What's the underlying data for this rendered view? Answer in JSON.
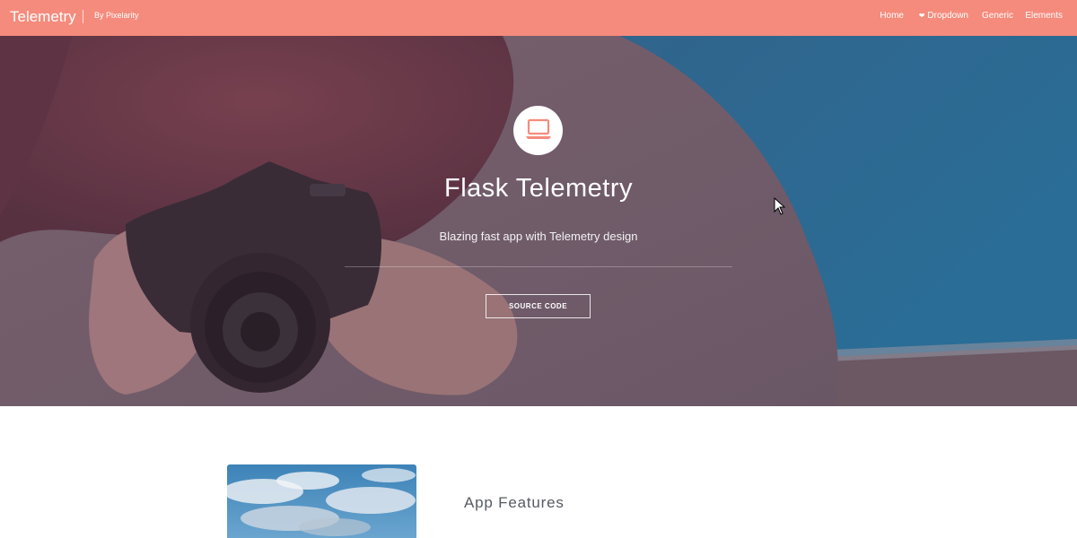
{
  "header": {
    "brand": "Telemetry",
    "by_line": "By Pixelarity",
    "nav": [
      {
        "label": "Home"
      },
      {
        "label": "Dropdown",
        "icon": "heart-icon"
      },
      {
        "label": "Generic"
      },
      {
        "label": "Elements"
      }
    ]
  },
  "hero": {
    "icon": "laptop-icon",
    "title": "Flask Telemetry",
    "subtitle": "Blazing fast app with Telemetry design",
    "button_label": "SOURCE CODE"
  },
  "features": {
    "title": "App Features"
  },
  "colors": {
    "header_bg": "#f58b7c",
    "accent": "#f58b7c",
    "hero_overlay": "#6e3a4e"
  }
}
